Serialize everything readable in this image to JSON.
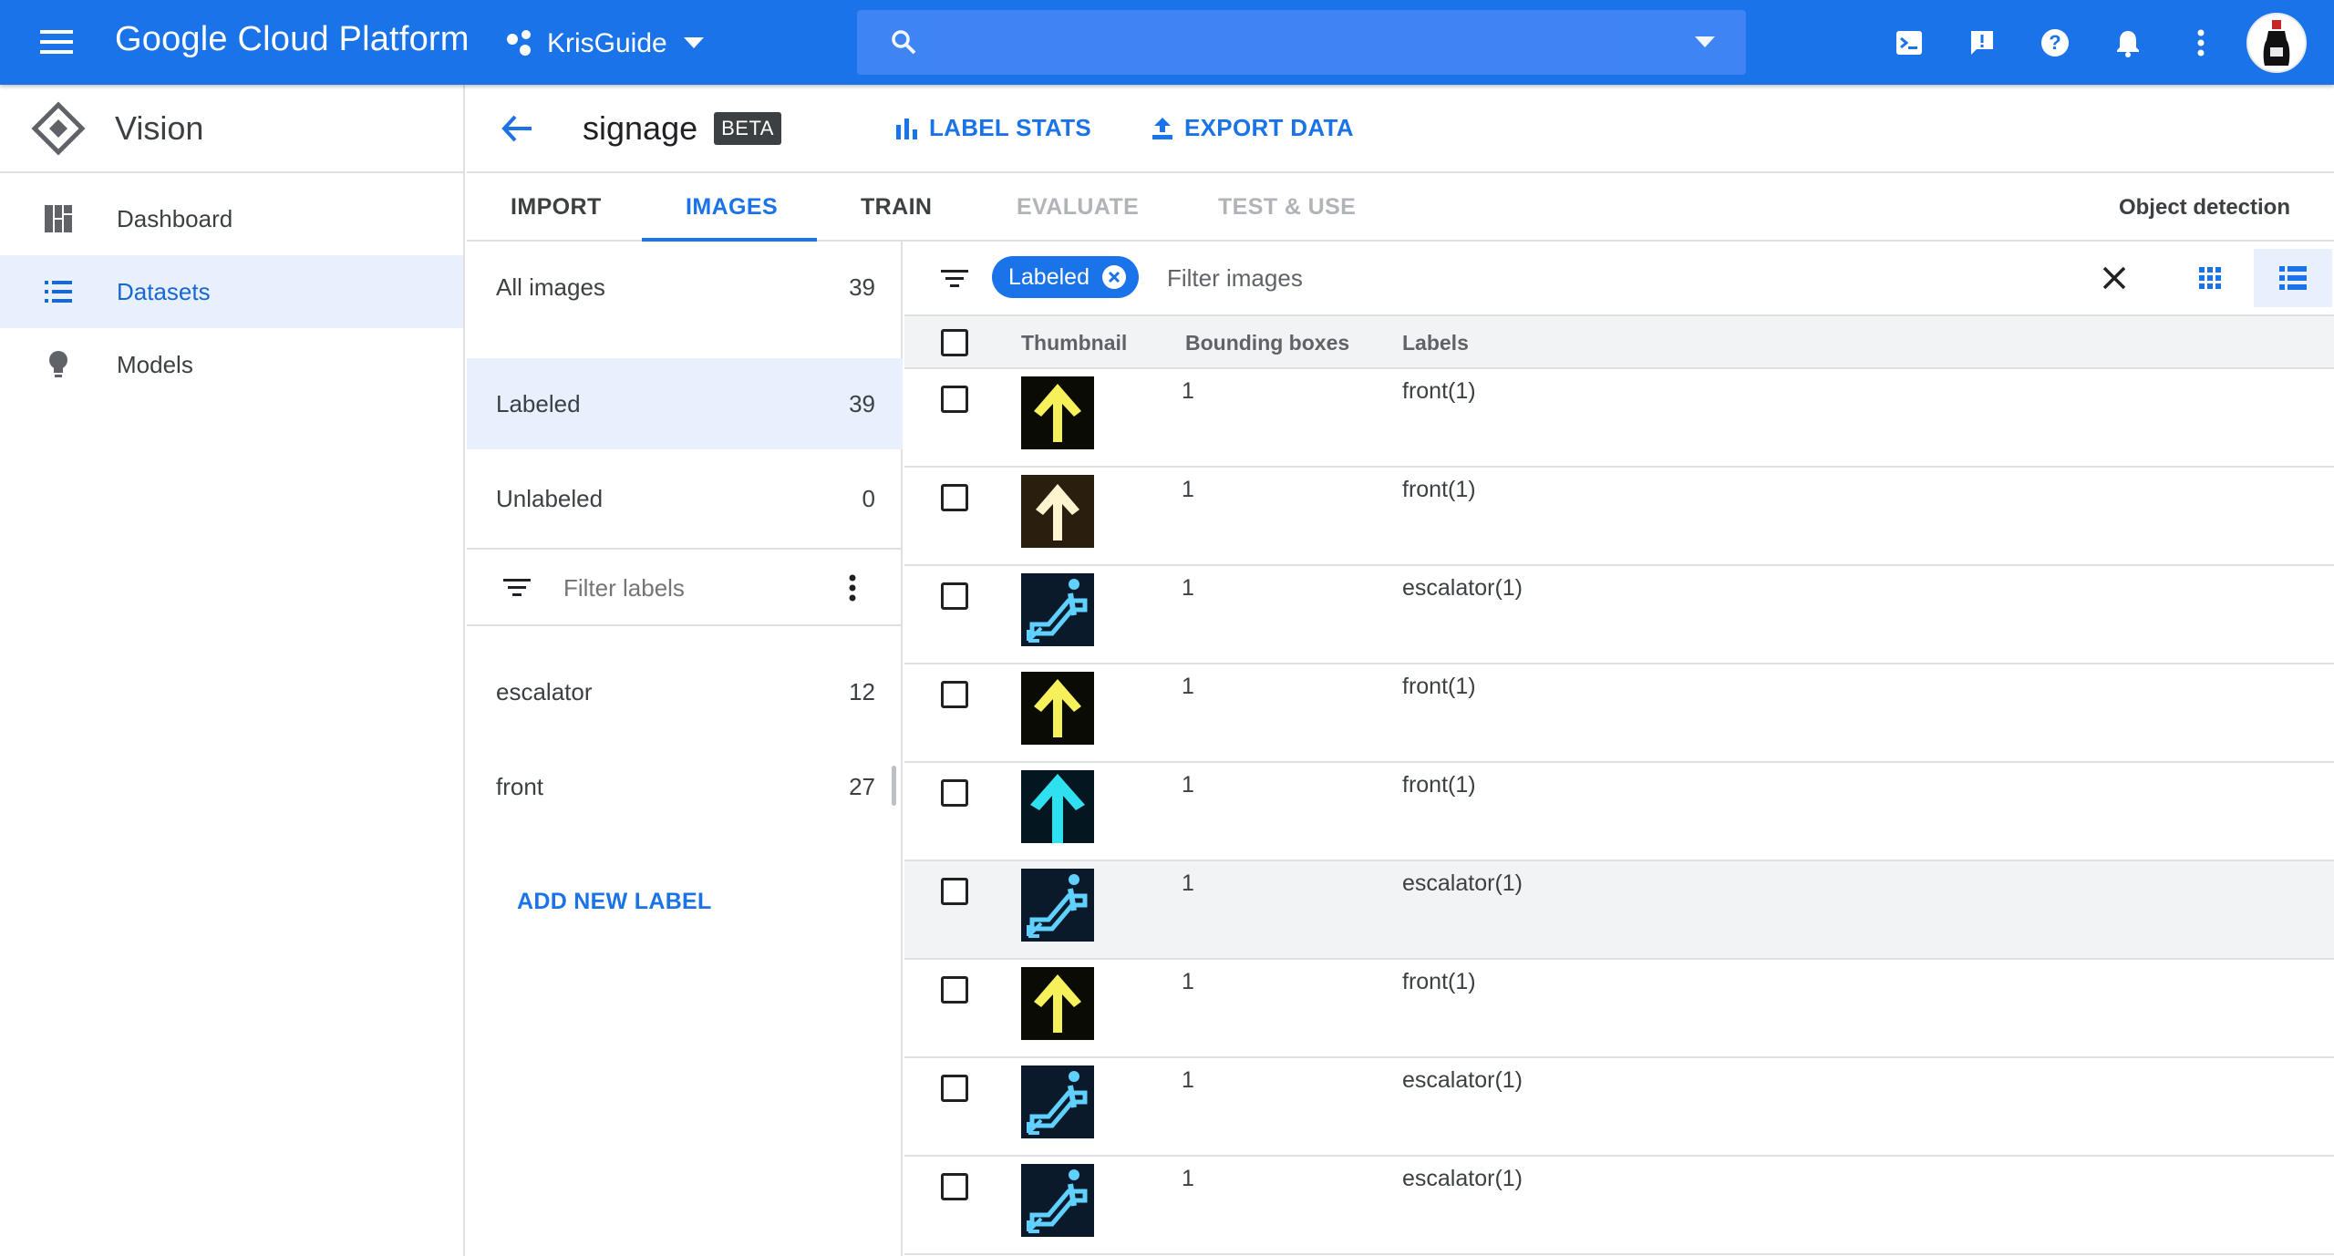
{
  "topbar": {
    "brand": "Google Cloud Platform",
    "project": "KrisGuide",
    "search_placeholder": ""
  },
  "leftnav": {
    "title": "Vision",
    "items": [
      {
        "label": "Dashboard",
        "icon": "dashboard-icon"
      },
      {
        "label": "Datasets",
        "icon": "list-icon",
        "active": true
      },
      {
        "label": "Models",
        "icon": "lightbulb-icon"
      }
    ]
  },
  "dataset": {
    "name": "signage",
    "badge": "BETA",
    "label_stats": "LABEL STATS",
    "export_data": "EXPORT DATA"
  },
  "tabs": [
    {
      "label": "IMPORT",
      "state": "normal"
    },
    {
      "label": "IMAGES",
      "state": "active"
    },
    {
      "label": "TRAIN",
      "state": "normal"
    },
    {
      "label": "EVALUATE",
      "state": "disabled"
    },
    {
      "label": "TEST & USE",
      "state": "disabled"
    }
  ],
  "model_type": "Object detection",
  "filters": {
    "all": {
      "label": "All images",
      "count": "39"
    },
    "labeled": {
      "label": "Labeled",
      "count": "39"
    },
    "unlabeled": {
      "label": "Unlabeled",
      "count": "0"
    },
    "filter_labels_placeholder": "Filter labels",
    "labels": [
      {
        "name": "escalator",
        "count": "12"
      },
      {
        "name": "front",
        "count": "27"
      }
    ],
    "add_new_label": "ADD NEW LABEL"
  },
  "table": {
    "chip": "Labeled",
    "filter_placeholder": "Filter images",
    "headers": {
      "thumbnail": "Thumbnail",
      "boxes": "Bounding boxes",
      "labels": "Labels"
    },
    "rows": [
      {
        "thumb": "yellow-arrow",
        "boxes": "1",
        "labels": "front(1)"
      },
      {
        "thumb": "white-arrow",
        "boxes": "1",
        "labels": "front(1)"
      },
      {
        "thumb": "escalator",
        "boxes": "1",
        "labels": "escalator(1)"
      },
      {
        "thumb": "yellow-arrow",
        "boxes": "1",
        "labels": "front(1)"
      },
      {
        "thumb": "cyan-arrow",
        "boxes": "1",
        "labels": "front(1)"
      },
      {
        "thumb": "escalator",
        "boxes": "1",
        "labels": "escalator(1)"
      },
      {
        "thumb": "yellow-arrow",
        "boxes": "1",
        "labels": "front(1)"
      },
      {
        "thumb": "escalator",
        "boxes": "1",
        "labels": "escalator(1)"
      },
      {
        "thumb": "escalator",
        "boxes": "1",
        "labels": "escalator(1)"
      }
    ]
  },
  "colors": {
    "accent": "#1a73e8",
    "topbar": "#1a73e8",
    "selected_bg": "#e8f0fe"
  }
}
